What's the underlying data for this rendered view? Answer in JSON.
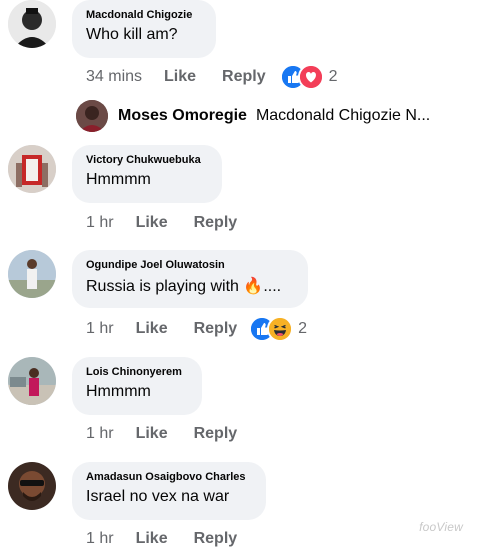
{
  "comments": [
    {
      "name": "Macdonald Chigozie",
      "text": "Who kill am?",
      "time": "34 mins",
      "like": "Like",
      "reply": "Reply",
      "reaction_count": "2"
    },
    {
      "name": "Victory Chukwuebuka",
      "text": "Hmmmm",
      "time": "1 hr",
      "like": "Like",
      "reply": "Reply"
    },
    {
      "name": "Ogundipe Joel Oluwatosin",
      "text": "Russia is playing with",
      "emoji": "🔥",
      "suffix": "....",
      "time": "1 hr",
      "like": "Like",
      "reply": "Reply",
      "reaction_count": "2"
    },
    {
      "name": "Lois Chinonyerem",
      "text": "Hmmmm",
      "time": "1 hr",
      "like": "Like",
      "reply": "Reply"
    },
    {
      "name": "Amadasun Osaigbovo Charles",
      "text": "Israel no vex na war",
      "time": "1 hr",
      "like": "Like",
      "reply": "Reply"
    }
  ],
  "reply_preview": {
    "name": "Moses Omoregie",
    "text": "Macdonald Chigozie N..."
  },
  "watermark": "fooView",
  "colors": {
    "like_blue": "#1877f2",
    "love_red": "#f33e58",
    "haha_yellow": "#f7b125",
    "bubble_bg": "#f0f2f5",
    "meta_gray": "#65676b"
  }
}
